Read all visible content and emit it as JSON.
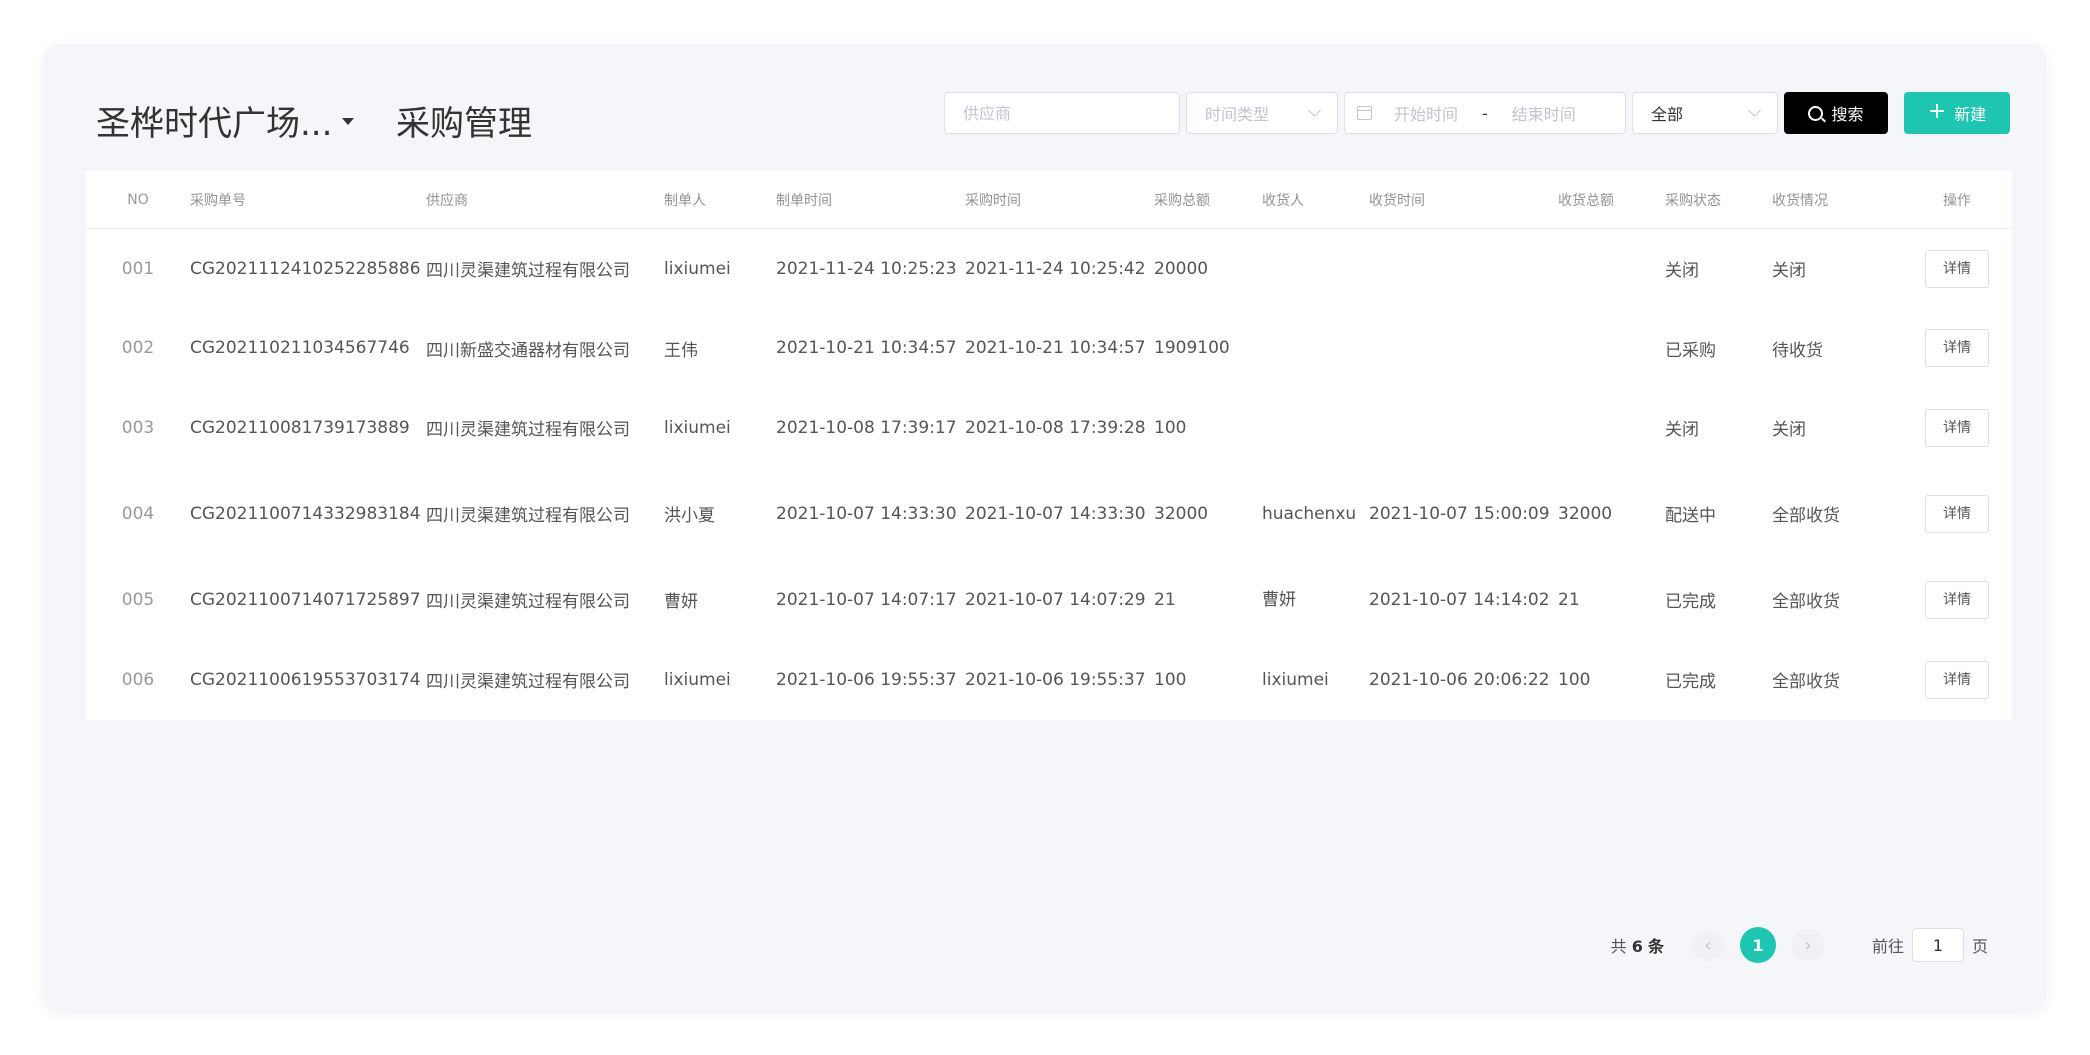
{
  "header": {
    "project_name": "圣桦时代广场...",
    "page_title": "采购管理"
  },
  "filters": {
    "supplier_placeholder": "供应商",
    "time_type_placeholder": "时间类型",
    "start_placeholder": "开始时间",
    "range_separator": "-",
    "end_placeholder": "结束时间",
    "status_value": "全部",
    "search_label": "搜索",
    "new_label": "新建"
  },
  "table": {
    "columns": [
      "NO",
      "采购单号",
      "供应商",
      "制单人",
      "制单时间",
      "采购时间",
      "采购总额",
      "收货人",
      "收货时间",
      "收货总额",
      "采购状态",
      "收货情况",
      "操作"
    ],
    "rows": [
      {
        "no": "001",
        "order_no": "CG2021112410252285886",
        "supplier": "四川灵渠建筑过程有限公司",
        "creator": "lixiumei",
        "created_at": "2021-11-24 10:25:23",
        "purchase_at": "2021-11-24 10:25:42",
        "purchase_total": "20000",
        "receiver": "",
        "received_at": "",
        "received_total": "",
        "purchase_status": "关闭",
        "receive_status": "关闭",
        "action": "详情"
      },
      {
        "no": "002",
        "order_no": "CG202110211034567746",
        "supplier": "四川新盛交通器材有限公司",
        "creator": "王伟",
        "created_at": "2021-10-21 10:34:57",
        "purchase_at": "2021-10-21 10:34:57",
        "purchase_total": "1909100",
        "receiver": "",
        "received_at": "",
        "received_total": "",
        "purchase_status": "已采购",
        "receive_status": "待收货",
        "action": "详情"
      },
      {
        "no": "003",
        "order_no": "CG202110081739173889",
        "supplier": "四川灵渠建筑过程有限公司",
        "creator": "lixiumei",
        "created_at": "2021-10-08 17:39:17",
        "purchase_at": "2021-10-08 17:39:28",
        "purchase_total": "100",
        "receiver": "",
        "received_at": "",
        "received_total": "",
        "purchase_status": "关闭",
        "receive_status": "关闭",
        "action": "详情"
      },
      {
        "no": "004",
        "order_no": "CG2021100714332983184",
        "supplier": "四川灵渠建筑过程有限公司",
        "creator": "洪小夏",
        "created_at": "2021-10-07 14:33:30",
        "purchase_at": "2021-10-07 14:33:30",
        "purchase_total": "32000",
        "receiver": "huachenxu",
        "received_at": "2021-10-07 15:00:09",
        "received_total": "32000",
        "purchase_status": "配送中",
        "receive_status": "全部收货",
        "action": "详情"
      },
      {
        "no": "005",
        "order_no": "CG2021100714071725897",
        "supplier": "四川灵渠建筑过程有限公司",
        "creator": "曹妍",
        "created_at": "2021-10-07 14:07:17",
        "purchase_at": "2021-10-07 14:07:29",
        "purchase_total": "21",
        "receiver": "曹妍",
        "received_at": "2021-10-07 14:14:02",
        "received_total": "21",
        "purchase_status": "已完成",
        "receive_status": "全部收货",
        "action": "详情"
      },
      {
        "no": "006",
        "order_no": "CG2021100619553703174",
        "supplier": "四川灵渠建筑过程有限公司",
        "creator": "lixiumei",
        "created_at": "2021-10-06 19:55:37",
        "purchase_at": "2021-10-06 19:55:37",
        "purchase_total": "100",
        "receiver": "lixiumei",
        "received_at": "2021-10-06 20:06:22",
        "received_total": "100",
        "purchase_status": "已完成",
        "receive_status": "全部收货",
        "action": "详情"
      }
    ]
  },
  "pagination": {
    "total_prefix": "共",
    "total_count": "6",
    "total_suffix": "条",
    "prev_icon": "‹",
    "current_page": "1",
    "next_icon": "›",
    "goto_prefix": "前往",
    "goto_value": "1",
    "goto_suffix": "页"
  },
  "colors": {
    "accent": "#1ec6b2",
    "search_button": "#000000",
    "card_background": "#f5f6fa"
  }
}
